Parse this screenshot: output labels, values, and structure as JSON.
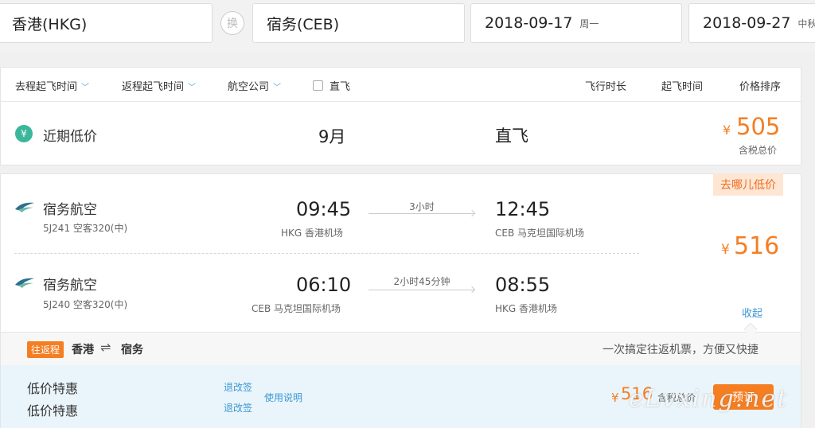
{
  "search": {
    "from": "香港(HKG)",
    "swap": "换",
    "to": "宿务(CEB)",
    "depart_date": "2018-09-17",
    "depart_weekday": "周一",
    "return_date": "2018-09-27",
    "return_weekday": "中秋后"
  },
  "filters": {
    "outbound_time": "去程起飞时间",
    "return_time": "返程起飞时间",
    "airline": "航空公司",
    "direct": "直飞",
    "sort_duration": "飞行时长",
    "sort_depart": "起飞时间",
    "sort_price": "价格排序"
  },
  "recent": {
    "yen_icon": "¥",
    "label": "近期低价",
    "month": "9月",
    "type": "直飞",
    "currency": "¥",
    "price": "505",
    "price_note": "含税总价"
  },
  "flight": {
    "badge": "去哪儿低价",
    "currency": "¥",
    "price": "516",
    "collapse": "收起",
    "legs": [
      {
        "airline": "宿务航空",
        "info": "5J241 空客320(中)",
        "dep_time": "09:45",
        "dep_airport": "HKG 香港机场",
        "duration": "3小时",
        "arr_time": "12:45",
        "arr_airport": "CEB 马克坦国际机场"
      },
      {
        "airline": "宿务航空",
        "info": "5J240 空客320(中)",
        "dep_time": "06:10",
        "dep_airport": "CEB 马克坦国际机场",
        "duration": "2小时45分钟",
        "arr_time": "08:55",
        "arr_airport": "HKG 香港机场"
      }
    ]
  },
  "roundtrip": {
    "tag": "往返程",
    "from": "香港",
    "arrow": "⇌",
    "to": "宿务",
    "slogan": "一次搞定往返机票，方便又快捷"
  },
  "offer": {
    "label1": "低价特惠",
    "label2": "低价特惠",
    "refund1": "退改签",
    "refund2": "退改签",
    "instructions": "使用说明",
    "currency": "¥",
    "price": "516",
    "price_note": "含税总价",
    "book": "预订"
  },
  "watermark": "eLvxing.net",
  "colors": {
    "accent_orange": "#f57e22",
    "link_blue": "#3b97d3",
    "teal": "#3ab79b"
  }
}
